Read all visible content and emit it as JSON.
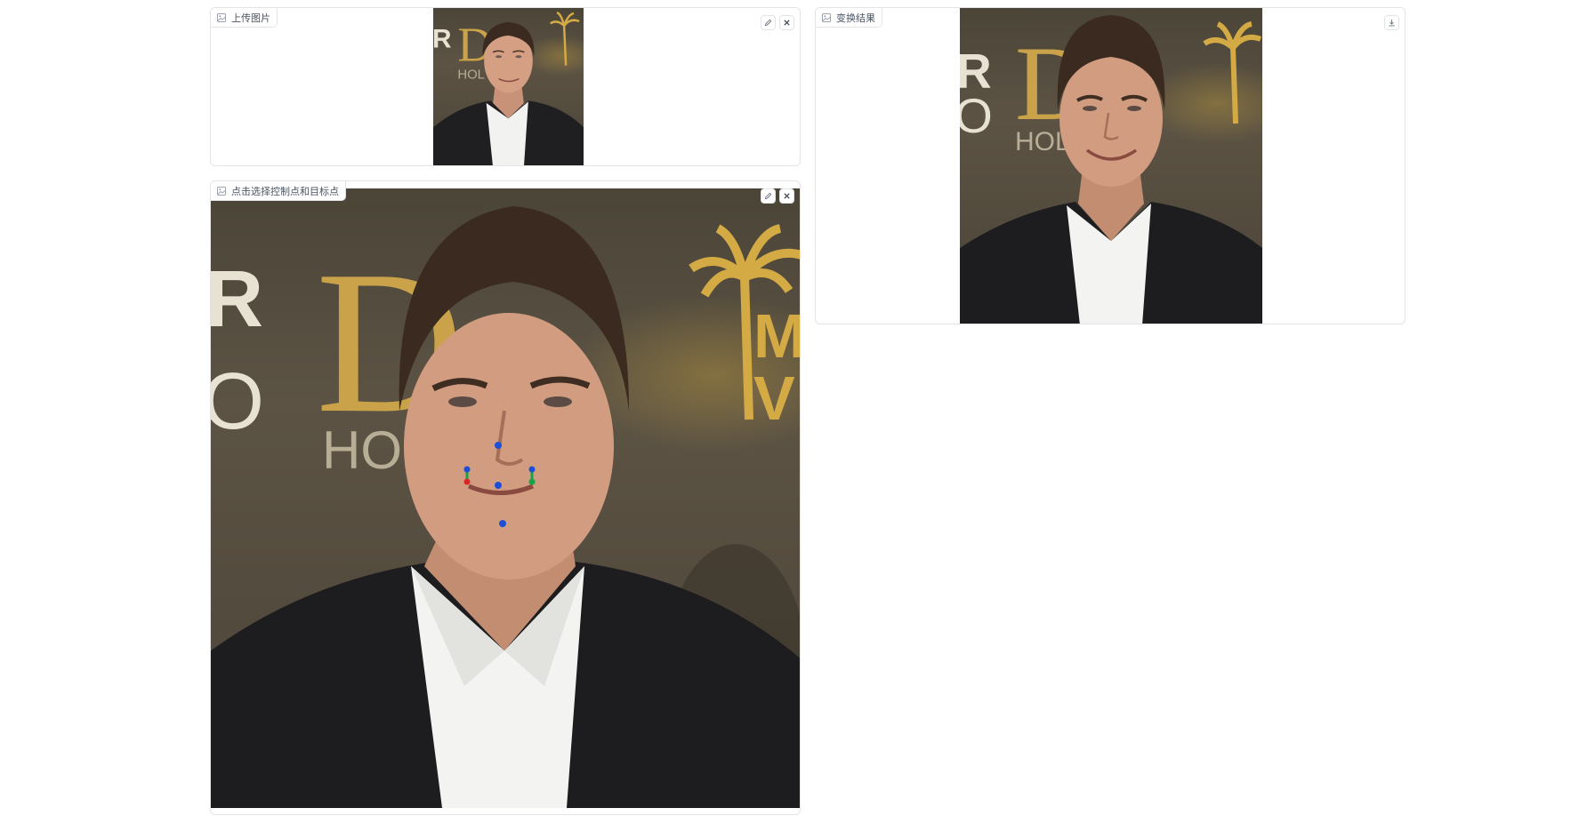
{
  "panels": {
    "upload": {
      "label": "上传图片",
      "label_icon": "image-icon",
      "actions": [
        "edit-icon",
        "close-icon"
      ]
    },
    "select_points": {
      "label": "点击选择控制点和目标点",
      "label_icon": "image-icon",
      "actions": [
        "edit-icon",
        "close-icon"
      ]
    },
    "result": {
      "label": "变换结果",
      "label_icon": "image-icon",
      "actions": [
        "download-icon"
      ]
    }
  },
  "photo": {
    "backdrop_letters_left": "R",
    "backdrop_letters_left2": "O",
    "backdrop_big_letter": "D",
    "backdrop_word": "HOL",
    "backdrop_right_letters": "M",
    "backdrop_right_letters2": "V"
  },
  "markers": {
    "control_color": "#1d4ed8",
    "drag_start_color": "#dc2626",
    "drag_end_color": "#16a34a"
  },
  "colors": {
    "border": "#e4e4e7",
    "gold": "#c9a24a"
  }
}
